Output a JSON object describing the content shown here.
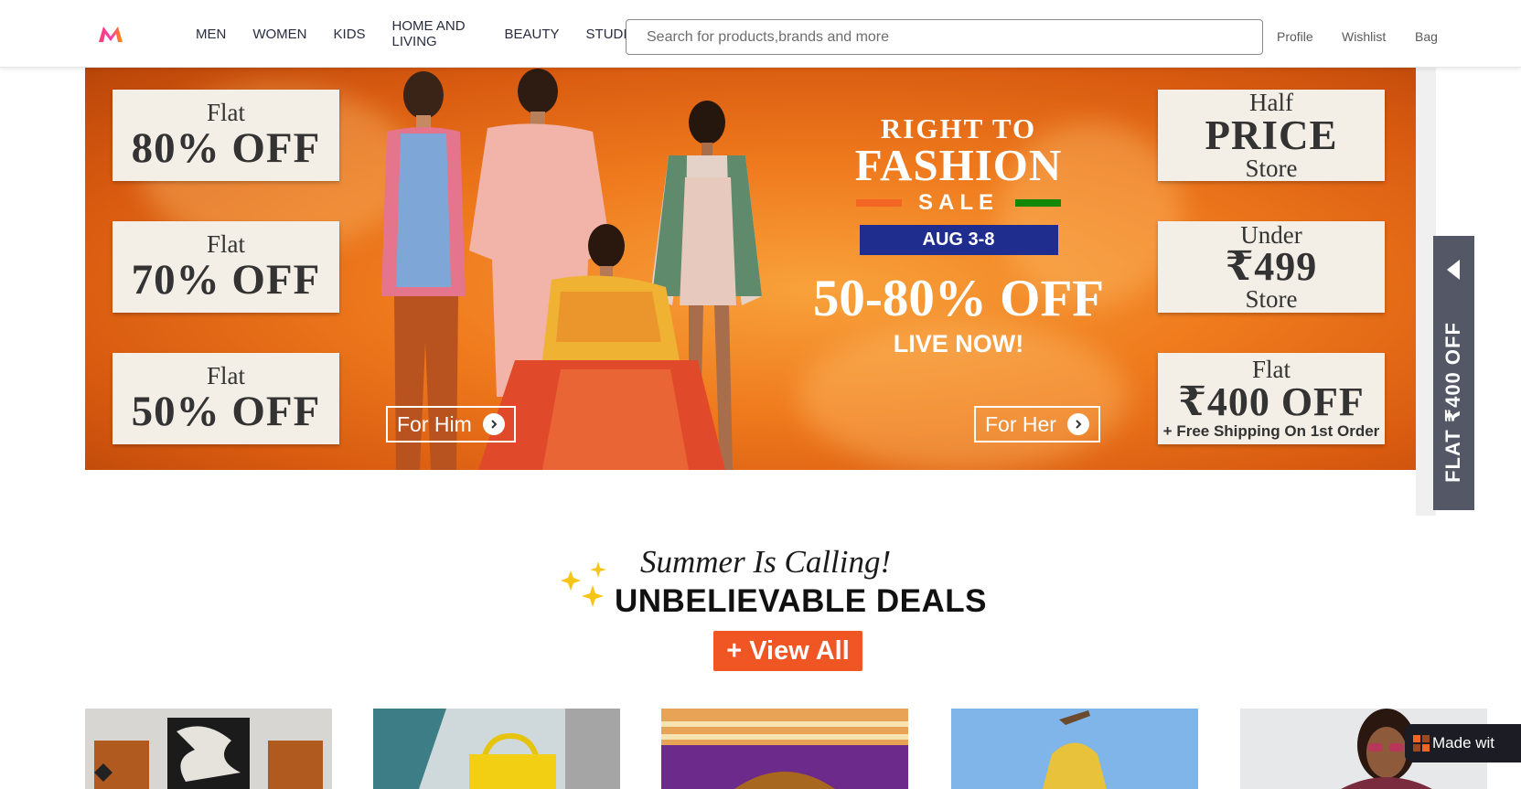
{
  "header": {
    "nav": [
      "MEN",
      "WOMEN",
      "KIDS",
      "HOME AND LIVING",
      "BEAUTY",
      "STUDIO"
    ],
    "search_placeholder": "Search for products,brands and more",
    "profile": "Profile",
    "wishlist": "Wishlist",
    "bag": "Bag"
  },
  "banner": {
    "left_cards": [
      {
        "small": "Flat",
        "big": "80% OFF"
      },
      {
        "small": "Flat",
        "big": "70% OFF"
      },
      {
        "small": "Flat",
        "big": "50% OFF"
      }
    ],
    "right_cards": {
      "half_small": "Half",
      "half_big": "PRICE",
      "half_store": "Store",
      "under_small": "Under",
      "under_big": "₹499",
      "under_store": "Store",
      "flat_small": "Flat",
      "flat_big": "₹400 OFF",
      "flat_note": "+ Free Shipping On 1st Order"
    },
    "sale_pre": "RIGHT TO",
    "sale_big": "FASHION",
    "sale_word": "SALE",
    "sale_date": "AUG 3-8",
    "sale_off": "50-80% OFF",
    "sale_live": "LIVE NOW!",
    "cta_him": "For Him",
    "cta_her": "For Her",
    "side_tab": "FLAT ₹400 OFF",
    "colors": {
      "saffron": "#f26522",
      "green": "#138808",
      "navy": "#1f2d8f",
      "orange": "#ef7a1d"
    }
  },
  "section": {
    "subtitle": "Summer Is Calling!",
    "title": "UNBELIEVABLE DEALS",
    "view_all": "+ View All",
    "accent": "#f05524"
  },
  "badge": {
    "made_with": "Made wit"
  }
}
